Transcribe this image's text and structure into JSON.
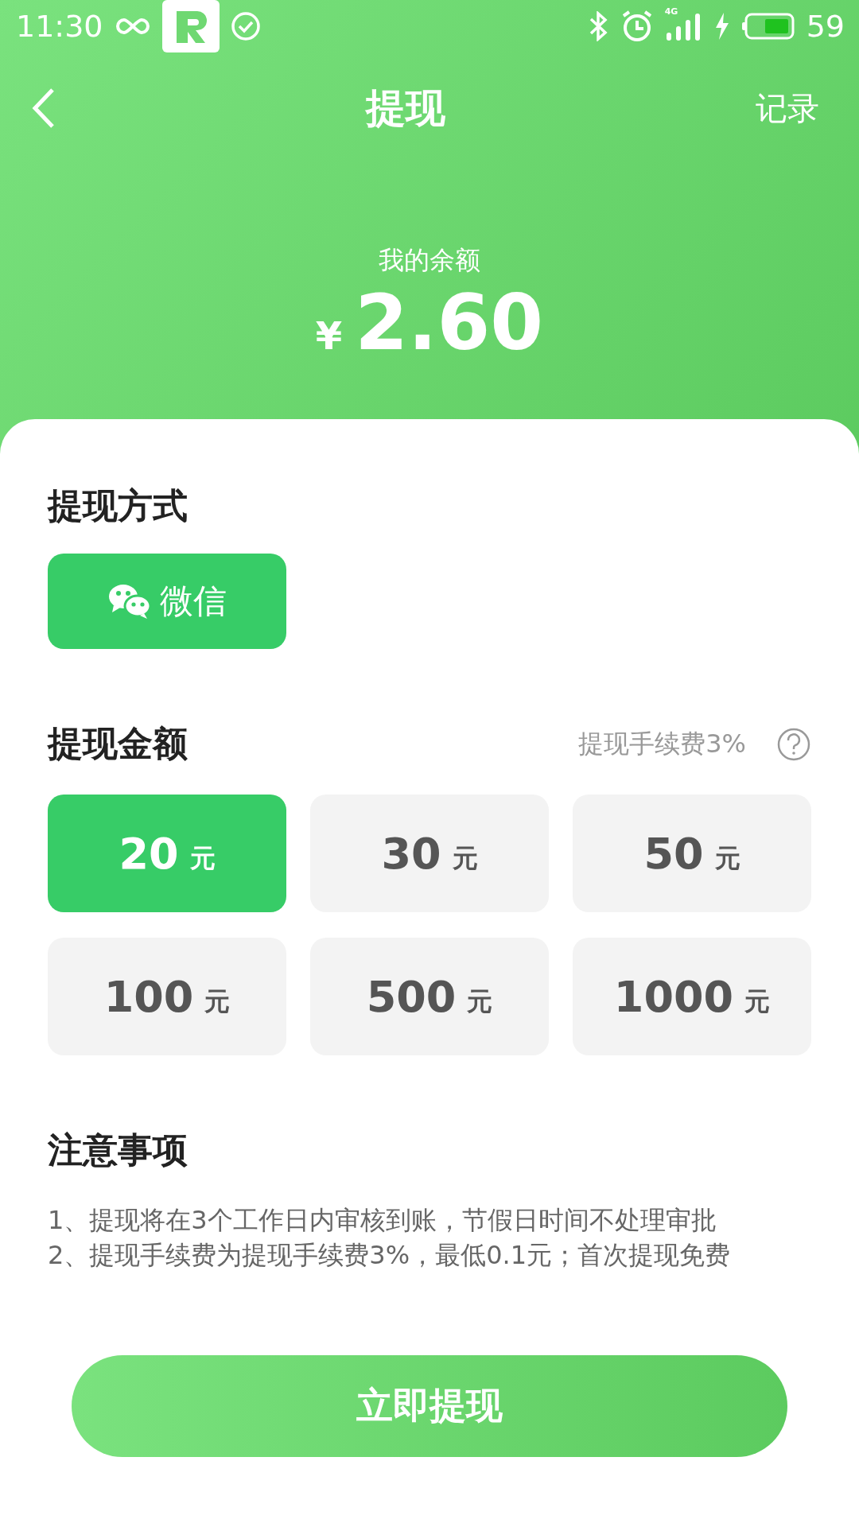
{
  "status_bar": {
    "time": "11:30",
    "network": "4G",
    "battery": "59"
  },
  "nav": {
    "title": "提现",
    "action": "记录"
  },
  "balance": {
    "label": "我的余额",
    "currency": "¥",
    "amount": "2.60"
  },
  "method": {
    "title": "提现方式",
    "options": [
      {
        "label": "微信",
        "selected": true
      }
    ]
  },
  "amount": {
    "title": "提现金额",
    "fee": "提现手续费3%",
    "options": [
      {
        "value": "20",
        "unit": "元",
        "selected": true
      },
      {
        "value": "30",
        "unit": "元",
        "selected": false
      },
      {
        "value": "50",
        "unit": "元",
        "selected": false
      },
      {
        "value": "100",
        "unit": "元",
        "selected": false
      },
      {
        "value": "500",
        "unit": "元",
        "selected": false
      },
      {
        "value": "1000",
        "unit": "元",
        "selected": false
      }
    ]
  },
  "notes": {
    "title": "注意事项",
    "items": [
      "1、提现将在3个工作日内审核到账，节假日时间不处理审批",
      "2、提现手续费为提现手续费3%，最低0.1元；首次提现免费"
    ]
  },
  "submit": "立即提现"
}
